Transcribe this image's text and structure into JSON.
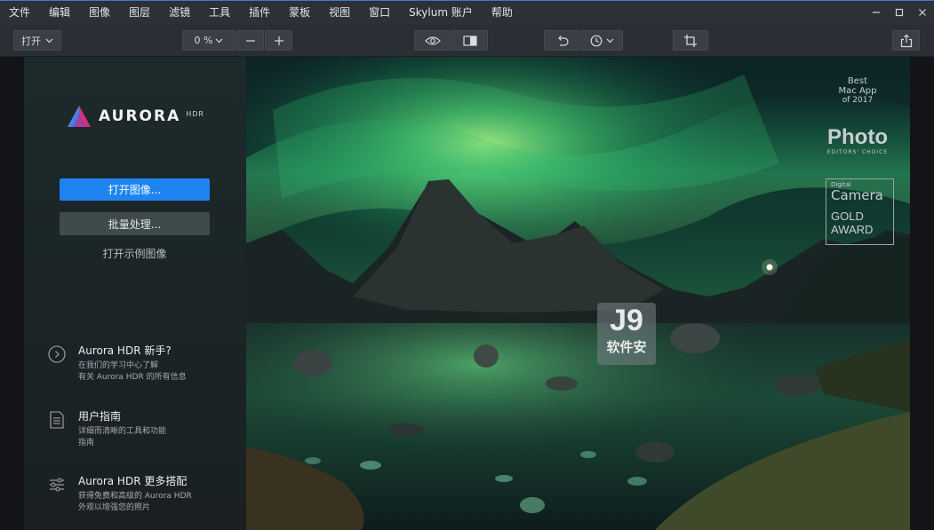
{
  "menubar": {
    "items": [
      "文件",
      "编辑",
      "图像",
      "图层",
      "滤镜",
      "工具",
      "插件",
      "蒙板",
      "视图",
      "窗口",
      "Skylum 账户",
      "帮助"
    ],
    "window_controls": {
      "minimize_icon": "minimize-icon",
      "maximize_icon": "maximize-icon",
      "close_icon": "close-icon"
    }
  },
  "toolbar": {
    "open_label": "打开",
    "zoom_value": "0 %",
    "minus_label": "—",
    "plus_label": "+"
  },
  "panel": {
    "logo_word": "AURORA",
    "logo_sub": "HDR",
    "open_image_label": "打开图像...",
    "batch_label": "批量处理...",
    "sample_label": "打开示例图像",
    "info": [
      {
        "icon": "play-circle-icon",
        "title": "Aurora HDR 新手?",
        "line1": "在我们的学习中心了解",
        "line2": "有关 Aurora HDR 的所有信息"
      },
      {
        "icon": "document-icon",
        "title": "用户指南",
        "line1": "详细而清晰的工具和功能",
        "line2": "指南"
      },
      {
        "icon": "sliders-icon",
        "title": "Aurora HDR 更多搭配",
        "line1": "获得免费和高级的 Aurora HDR",
        "line2": "外观以增强您的照片"
      }
    ]
  },
  "awards": {
    "best_line1": "Best",
    "best_line2": "Mac App",
    "best_line3": "of 2017",
    "photo_word": "Photo",
    "photo_sub": "EDITORS' CHOICE",
    "digital": "Digital",
    "camera": "Camera",
    "gold": "GOLD",
    "award": "AWARD"
  },
  "watermark": {
    "logo": "J9",
    "text": "软件安",
    "text2": "件安"
  },
  "colors": {
    "accent": "#1e84f0",
    "menubar": "#2d3036",
    "toolbar": "#2b2e34"
  }
}
